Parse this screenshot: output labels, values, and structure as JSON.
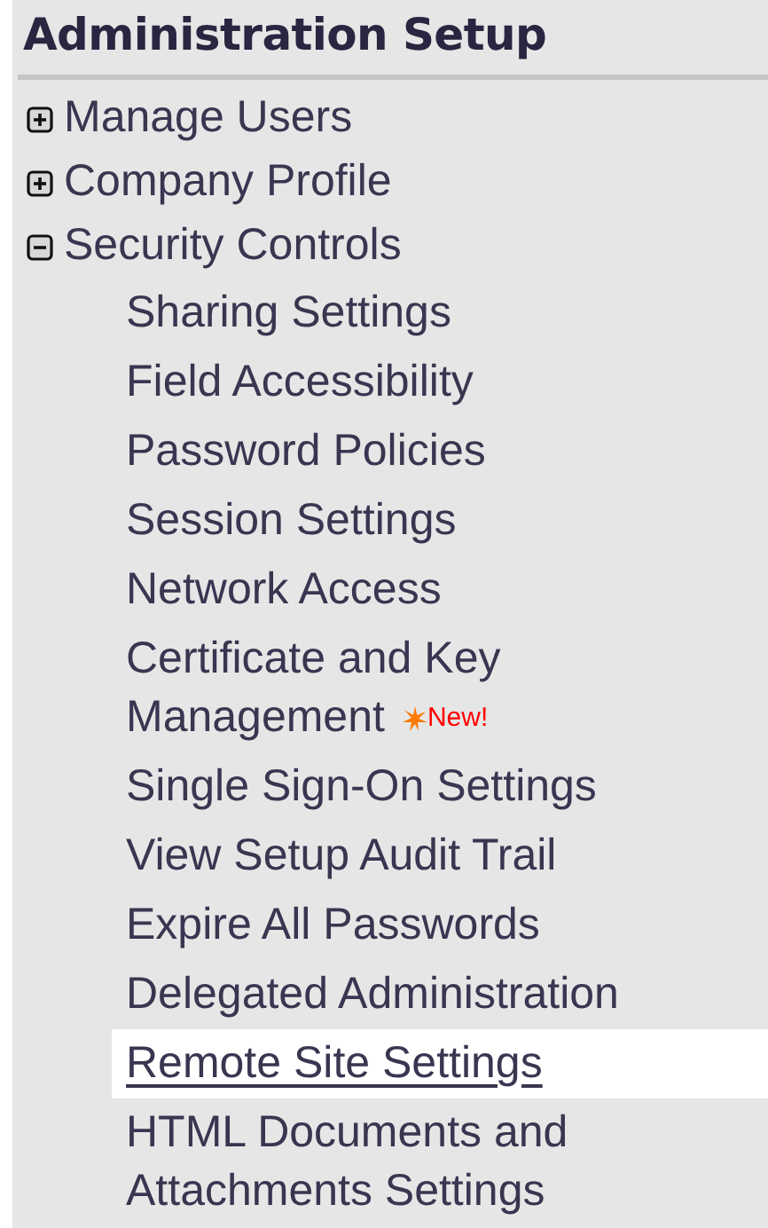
{
  "title": "Administration Setup",
  "items": [
    {
      "label": "Manage Users",
      "expanded": false
    },
    {
      "label": "Company Profile",
      "expanded": false
    },
    {
      "label": "Security Controls",
      "expanded": true,
      "children": [
        {
          "label": "Sharing Settings",
          "selected": false
        },
        {
          "label": "Field Accessibility",
          "selected": false
        },
        {
          "label": "Password Policies",
          "selected": false
        },
        {
          "label": "Session Settings",
          "selected": false
        },
        {
          "label": "Network Access",
          "selected": false
        },
        {
          "label": "Certificate and Key Management",
          "selected": false,
          "badge": "New!"
        },
        {
          "label": "Single Sign-On Settings",
          "selected": false
        },
        {
          "label": "View Setup Audit Trail",
          "selected": false
        },
        {
          "label": "Expire All Passwords",
          "selected": false
        },
        {
          "label": "Delegated Administration",
          "selected": false
        },
        {
          "label": "Remote Site Settings",
          "selected": true
        },
        {
          "label": "HTML Documents and Attachments Settings",
          "selected": false
        }
      ]
    }
  ]
}
